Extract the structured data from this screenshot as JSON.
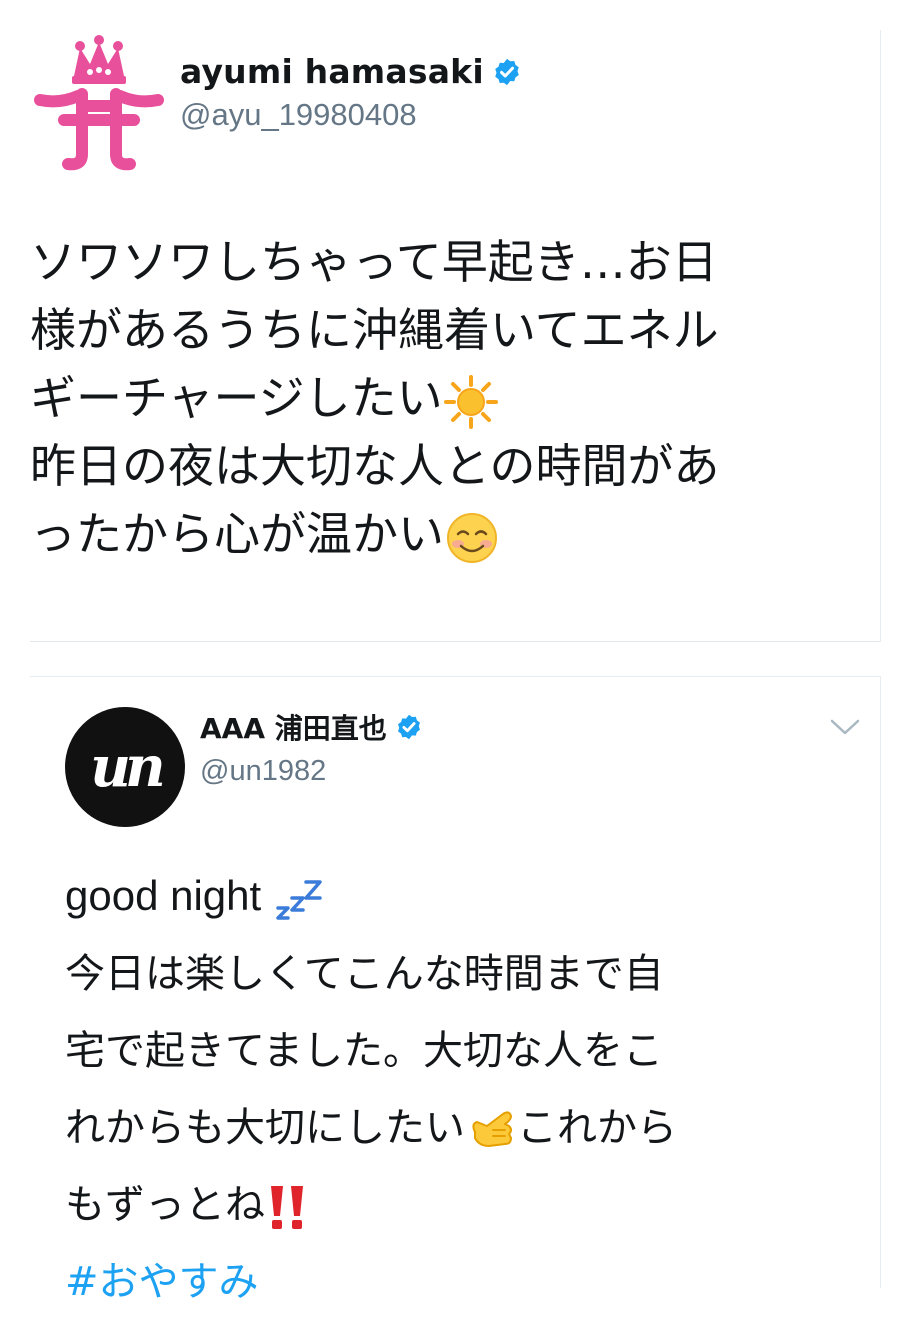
{
  "tweets": [
    {
      "author": {
        "name": "ayumi hamasaki",
        "handle": "@ayu_19980408",
        "avatar_icon": "crown-ayu-logo-icon",
        "verified": true,
        "avatar_color": "#e8509b"
      },
      "lines": [
        "ソワソワしちゃって早起き…お日",
        "様があるうちに沖縄着いてエネル",
        "ギーチャージしたい",
        "昨日の夜は大切な人との時間があ",
        "ったから心が温かい"
      ],
      "emojis": {
        "line3": "sun-emoji-icon",
        "line5": "smiling-face-emoji-icon"
      }
    },
    {
      "author": {
        "name": "AAA 浦田直也",
        "handle": "@un1982",
        "avatar_text": "un",
        "verified": true,
        "menu_icon": "chevron-down-icon"
      },
      "lines": [
        "good night",
        "今日は楽しくてこんな時間まで自",
        "宅で起きてました。大切な人をこ",
        "れからも大切にしたい",
        "これから",
        "もずっとね",
        "#おやすみ"
      ],
      "emojis": {
        "line1": "zzz-emoji-icon",
        "line4": "call-me-hand-emoji-icon",
        "line5": "double-exclamation-emoji-icon"
      }
    }
  ],
  "colors": {
    "verified": "#1da1f2",
    "hashtag": "#1da1f2",
    "handle": "#657786",
    "text": "#14171a"
  }
}
